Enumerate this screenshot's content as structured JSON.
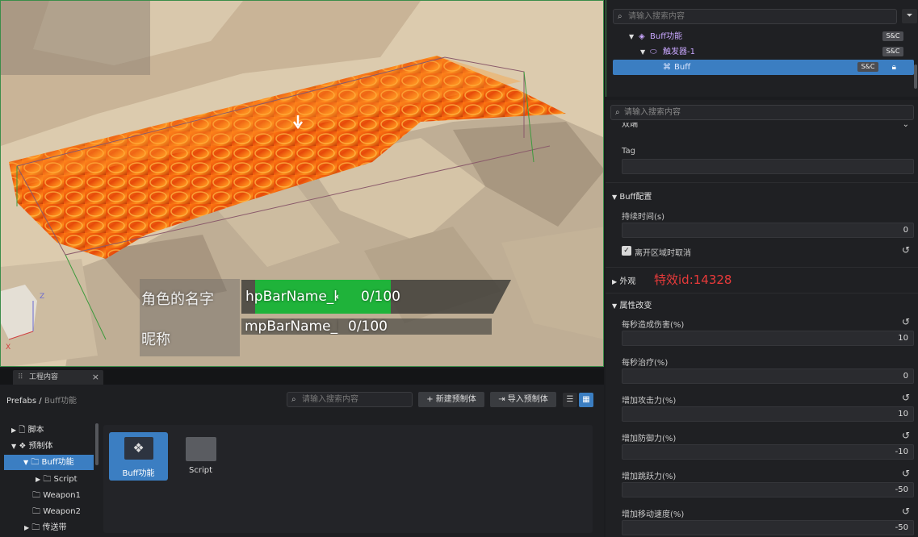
{
  "hud": {
    "name_label": "角色的名字",
    "nick_label": "昵称",
    "hp_bar_name": "hpBarName_k",
    "hp_value": "0/100",
    "mp_bar_name": "mpBarName_l",
    "mp_value": "0/100",
    "axis_z": "Z",
    "axis_x": "X"
  },
  "hierarchy": {
    "search_placeholder": "请输入搜索内容",
    "rows": [
      {
        "label": "Buff功能",
        "badge": "S&C"
      },
      {
        "label": "触发器-1",
        "badge": "S&C"
      },
      {
        "label": "Buff",
        "badge": "S&C"
      }
    ]
  },
  "inspector": {
    "search_placeholder": "请输入搜索内容",
    "top_select_value": "双端",
    "tag_label": "Tag",
    "tag_value": "",
    "buff_section": "Buff配置",
    "duration_label": "持续时间(s)",
    "duration_value": "0",
    "leave_cancel_label": "离开区域时取消",
    "appearance_section": "外观",
    "effect_id_annotation": "特效id:14328",
    "attr_section": "属性改变",
    "attrs": [
      {
        "label": "每秒造成伤害(%)",
        "value": "10"
      },
      {
        "label": "每秒治疗(%)",
        "value": "0"
      },
      {
        "label": "增加攻击力(%)",
        "value": "10"
      },
      {
        "label": "增加防御力(%)",
        "value": "-10"
      },
      {
        "label": "增加跳跃力(%)",
        "value": "-50"
      },
      {
        "label": "增加移动速度(%)",
        "value": "-50"
      }
    ]
  },
  "project": {
    "tab_title": "工程内容",
    "breadcrumb_root": "Prefabs",
    "breadcrumb_sep": "/",
    "breadcrumb_current": "Buff功能",
    "search_placeholder": "请输入搜索内容",
    "new_prefab_label": "新建预制体",
    "import_prefab_label": "导入预制体",
    "tree": [
      {
        "label": "脚本"
      },
      {
        "label": "预制体"
      },
      {
        "label": "Buff功能"
      },
      {
        "label": "Script"
      },
      {
        "label": "Weapon1"
      },
      {
        "label": "Weapon2"
      },
      {
        "label": "传送带"
      }
    ],
    "cards": [
      {
        "label": "Buff功能"
      },
      {
        "label": "Script"
      }
    ]
  }
}
